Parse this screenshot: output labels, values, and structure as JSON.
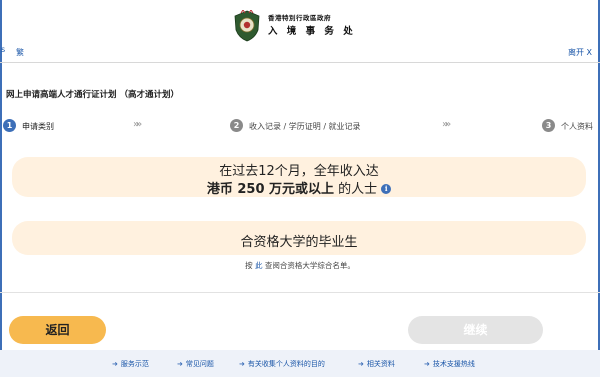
{
  "header": {
    "dept_small": "香港特別行政區政府",
    "dept_main": "入 境 事 务 处",
    "lang_toggle": "繁",
    "left_caret": "s",
    "exit": "离开 X"
  },
  "page_title": "网上申请高端人才通行证计划 （高才通计划）",
  "steps": [
    {
      "num": "1",
      "label": "申请类别"
    },
    {
      "num": "2",
      "label": "收入记录 / 学历证明 / 就业记录"
    },
    {
      "num": "3",
      "label": "个人资料"
    }
  ],
  "chevron": "»»",
  "options": {
    "income": {
      "line1": "在过去12个月，全年收入达",
      "line2_bold": "港币 250 万元或以上",
      "line2_rest": " 的人士",
      "info": "i"
    },
    "graduate": {
      "line": "合资格大学的毕业生"
    }
  },
  "note": {
    "prefix": "按 ",
    "link": "此",
    "suffix": " 查阅合资格大学综合名单。"
  },
  "buttons": {
    "back": "返回",
    "next": "继续"
  },
  "bottom_links": [
    "服务示范",
    "常见问题",
    "有关收集个人资料的目的",
    "相关资料",
    "技术支援热线"
  ],
  "colors": {
    "accent_blue": "#3d6fb8",
    "card_bg": "#fff1df",
    "back_button": "#f7b94f"
  }
}
